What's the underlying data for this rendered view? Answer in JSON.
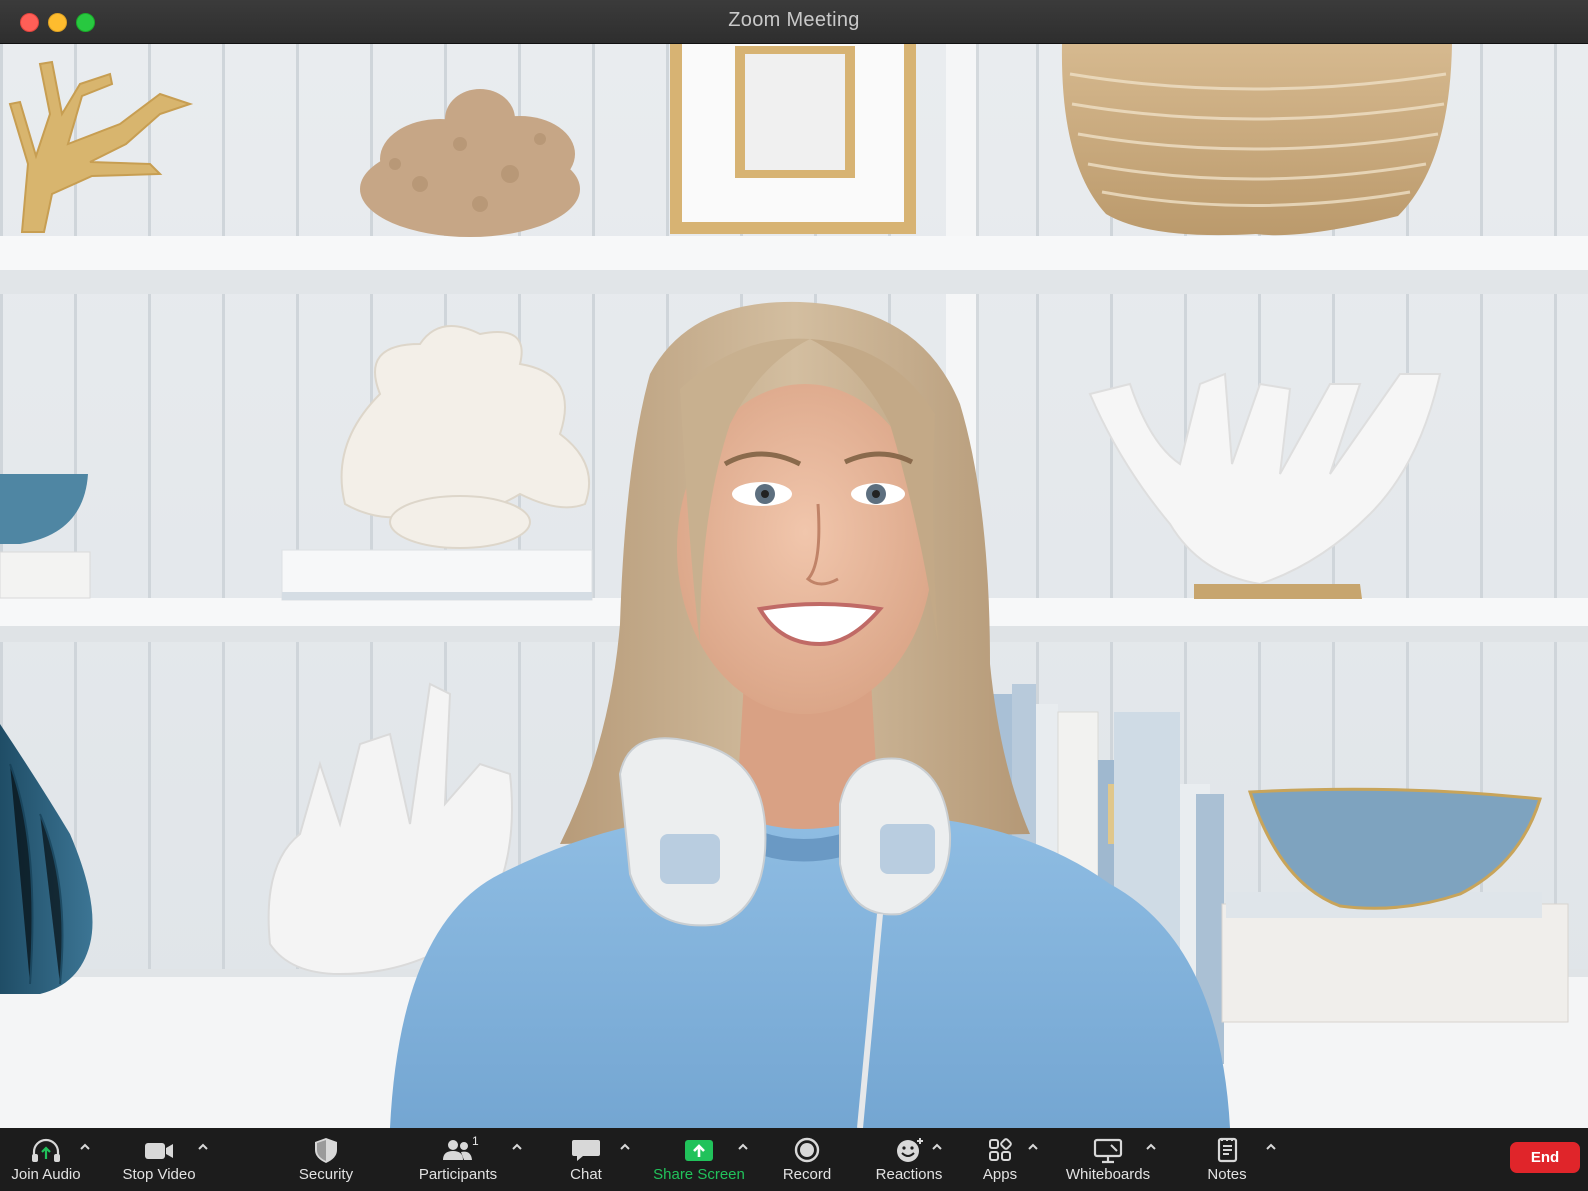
{
  "window": {
    "title": "Zoom Meeting"
  },
  "toolbar": {
    "join_audio": "Join Audio",
    "stop_video": "Stop Video",
    "security": "Security",
    "participants": "Participants",
    "participants_count": "1",
    "chat": "Chat",
    "share_screen": "Share Screen",
    "record": "Record",
    "reactions": "Reactions",
    "apps": "Apps",
    "whiteboards": "Whiteboards",
    "notes": "Notes",
    "end": "End"
  },
  "colors": {
    "share_screen_accent": "#21c25b",
    "end_button": "#e0252a",
    "toolbar_bg": "#1c1c1c"
  },
  "icons": {
    "join_audio": "headphone-arrow-icon",
    "stop_video": "video-camera-icon",
    "security": "shield-icon",
    "participants": "people-icon",
    "chat": "speech-bubble-icon",
    "share_screen": "share-arrow-icon",
    "record": "record-circle-icon",
    "reactions": "smiley-plus-icon",
    "apps": "apps-grid-icon",
    "whiteboards": "whiteboard-icon",
    "notes": "notes-icon",
    "caret": "caret-up-icon"
  }
}
